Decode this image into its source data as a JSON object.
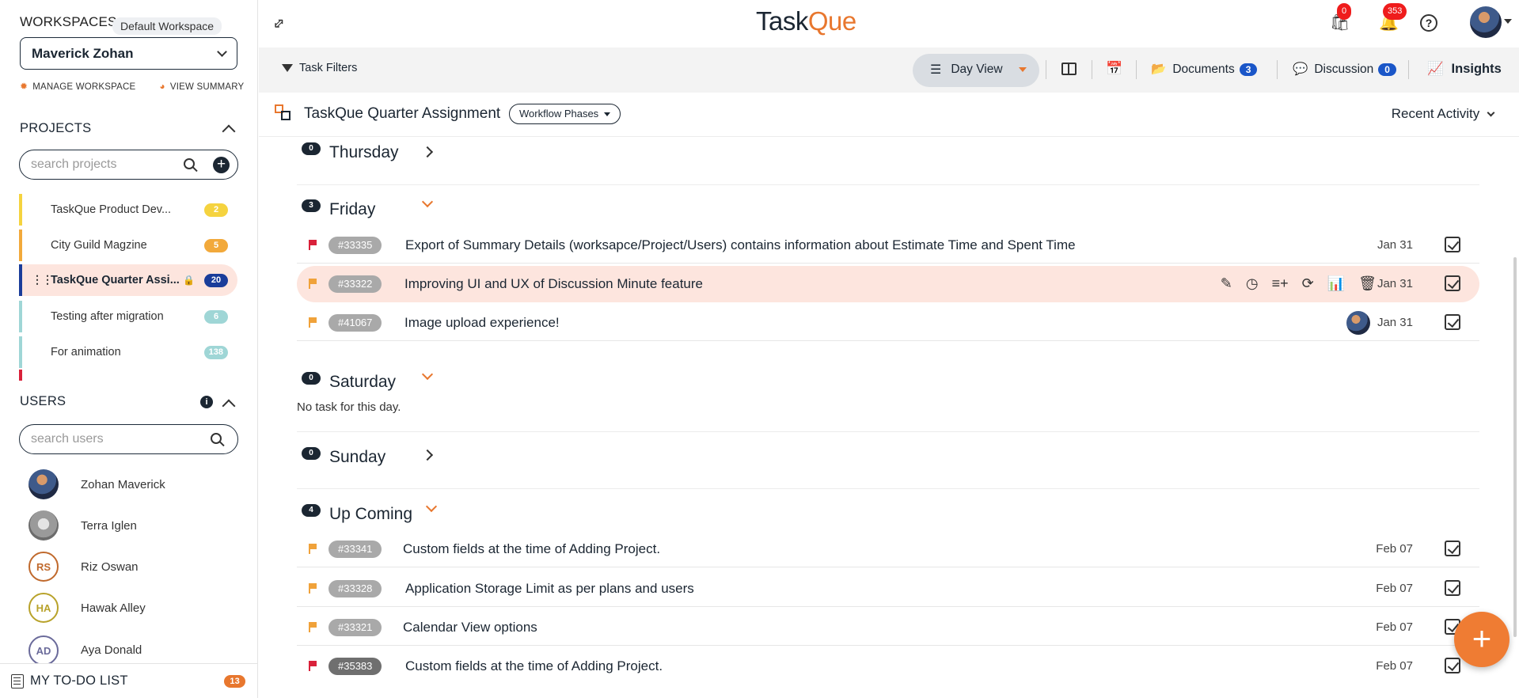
{
  "sidebar": {
    "workspaces_label": "WORKSPACES",
    "default_badge": "Default Workspace",
    "workspace_name": "Maverick Zohan",
    "manage_workspace": "MANAGE WORKSPACE",
    "view_summary": "VIEW SUMMARY",
    "projects_label": "PROJECTS",
    "search_projects_placeholder": "search projects",
    "projects": [
      {
        "name": "TaskQue Product Dev...",
        "count": "2",
        "color": "#f5d33f",
        "bar": "#f5d33f"
      },
      {
        "name": "City Guild Magzine",
        "count": "5",
        "color": "#f2a93b",
        "bar": "#f2a93b"
      },
      {
        "name": "TaskQue Quarter Assi...",
        "count": "20",
        "color": "#1a3d9a",
        "bar": "#1a3d9a"
      },
      {
        "name": "Testing after migration",
        "count": "6",
        "color": "#9fd6d6",
        "bar": "#9fd6d6"
      },
      {
        "name": "For animation",
        "count": "138",
        "color": "#9fd6d6",
        "bar": "#9fd6d6"
      }
    ],
    "users_label": "USERS",
    "search_users_placeholder": "search users",
    "users": [
      {
        "name": "Zohan Maverick",
        "initials": ""
      },
      {
        "name": "Terra Iglen",
        "initials": ""
      },
      {
        "name": "Riz Oswan",
        "initials": "RS"
      },
      {
        "name": "Hawak Alley",
        "initials": "HA"
      },
      {
        "name": "Aya Donald",
        "initials": "AD"
      }
    ],
    "todo_label": "MY TO-DO LIST",
    "todo_count": "13"
  },
  "header": {
    "logo_part1": "Task",
    "logo_part2": "Que",
    "cart_count": "0",
    "notifications_count": "353"
  },
  "toolbar": {
    "task_filters": "Task Filters",
    "day_view": "Day View",
    "documents": "Documents",
    "documents_count": "3",
    "discussion": "Discussion",
    "discussion_count": "0",
    "insights": "Insights"
  },
  "titlebar": {
    "title": "TaskQue Quarter Assignment",
    "workflow_phases": "Workflow Phases",
    "recent_activity": "Recent Activity"
  },
  "days": {
    "thursday": {
      "name": "Thursday",
      "count": "0"
    },
    "friday": {
      "name": "Friday",
      "count": "3"
    },
    "saturday": {
      "name": "Saturday",
      "count": "0",
      "empty": "No task for this day."
    },
    "sunday": {
      "name": "Sunday",
      "count": "0"
    },
    "upcoming": {
      "name": "Up Coming",
      "count": "4"
    }
  },
  "tasks": {
    "t1": {
      "id": "#33335",
      "name": "Export of Summary Details (worksapce/Project/Users) contains information about Estimate Time and Spent Time",
      "date": "Jan 31"
    },
    "t2": {
      "id": "#33322",
      "name": "Improving UI and UX of Discussion Minute feature",
      "date": "Jan 31"
    },
    "t3": {
      "id": "#41067",
      "name": "Image upload experience!",
      "date": "Jan 31"
    },
    "t4": {
      "id": "#33341",
      "name": "Custom fields at the time of Adding Project.",
      "date": "Feb 07"
    },
    "t5": {
      "id": "#33328",
      "name": "Application Storage Limit as per plans and users",
      "date": "Feb 07"
    },
    "t6": {
      "id": "#33321",
      "name": "Calendar View options",
      "date": "Feb 07"
    },
    "t7": {
      "id": "#35383",
      "name": "Custom fields at the time of Adding Project.",
      "date": "Feb 07"
    }
  },
  "colors": {
    "accent": "#e8772e",
    "navy": "#1b2632",
    "flag_red": "#d9213a",
    "flag_orange": "#f0a23a"
  }
}
